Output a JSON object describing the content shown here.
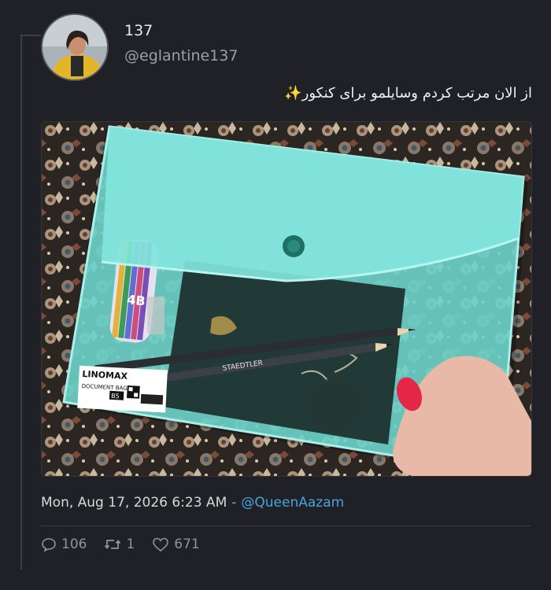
{
  "tweet": {
    "display_name": "137",
    "handle": "@eglantine137",
    "text": "از الان مرتب کردم وسایلمو برای کنکور✨",
    "timestamp": "Mon, Aug 17, 2026 6:23 AM",
    "separator": "-",
    "reply_to": "@QueenAazam",
    "image_labels": {
      "brand": "LINOMAX",
      "product": "DOCUMENT BAG",
      "size": "B5",
      "pencil_grade": "4B",
      "pencil_brand": "STAEDTLER"
    }
  },
  "stats": {
    "replies": "106",
    "retweets": "1",
    "likes": "671"
  },
  "colors": {
    "background": "#1f2126",
    "link": "#4aa3df",
    "muted": "#8e949b",
    "folder": "#6fd9cf"
  },
  "icons": {
    "reply": "comment-bubble-icon",
    "retweet": "retweet-icon",
    "like": "heart-icon"
  }
}
